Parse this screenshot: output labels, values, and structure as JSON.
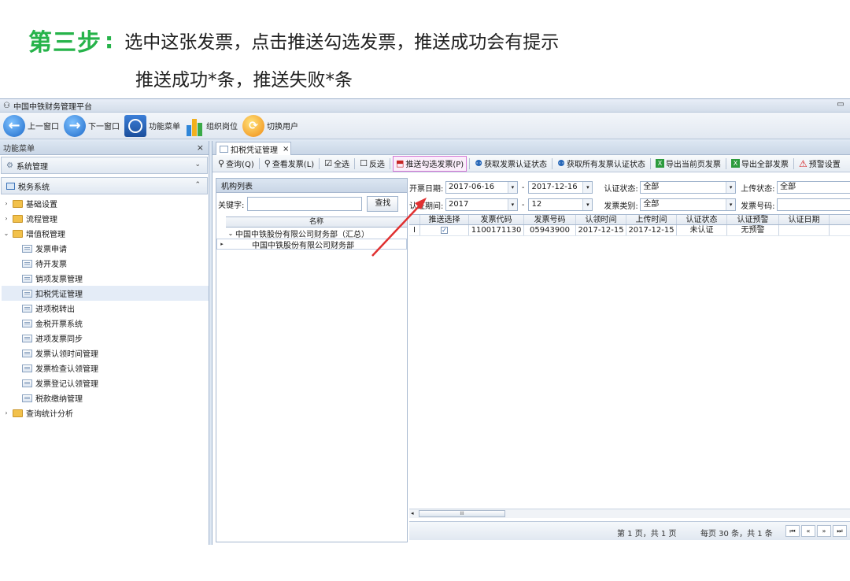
{
  "instructions": {
    "step_label": "第三步",
    "step_colon": ":",
    "line1": "选中这张发票，点击推送勾选发票，推送成功会有提示",
    "line2": "推送成功*条，推送失败*条"
  },
  "window": {
    "title": "中国中铁财务管理平台",
    "minimize": "▭"
  },
  "toolbar": {
    "prev": "上一窗口",
    "next": "下一窗口",
    "func_menu": "功能菜单",
    "org_post": "组织岗位",
    "switch_user": "切换用户"
  },
  "left_panel": {
    "title": "功能菜单",
    "close": "×",
    "group1": "系统管理",
    "group2": "税务系统",
    "tree": [
      {
        "label": "基础设置",
        "type": "folder",
        "arrow": "›"
      },
      {
        "label": "流程管理",
        "type": "folder",
        "arrow": "›"
      },
      {
        "label": "增值税管理",
        "type": "folder",
        "arrow": "⌄"
      },
      {
        "label": "发票申请",
        "type": "page"
      },
      {
        "label": "待开发票",
        "type": "page"
      },
      {
        "label": "销项发票管理",
        "type": "page"
      },
      {
        "label": "扣税凭证管理",
        "type": "page",
        "selected": true
      },
      {
        "label": "进项税转出",
        "type": "page"
      },
      {
        "label": "金税开票系统",
        "type": "page"
      },
      {
        "label": "进项发票同步",
        "type": "page"
      },
      {
        "label": "发票认领时间管理",
        "type": "page"
      },
      {
        "label": "发票检查认领管理",
        "type": "page"
      },
      {
        "label": "发票登记认领管理",
        "type": "page"
      },
      {
        "label": "税款缴纳管理",
        "type": "page"
      },
      {
        "label": "查询统计分析",
        "type": "folder",
        "arrow": "›"
      }
    ]
  },
  "tab": {
    "label": "扣税凭证管理",
    "close": "×"
  },
  "actions": {
    "query": "查询(Q)",
    "view_invoice": "查看发票(L)",
    "select_all": "全选",
    "invert": "反选",
    "push_selected": "推送勾选发票(P)",
    "get_status": "获取发票认证状态",
    "get_all_status": "获取所有发票认证状态",
    "export_page": "导出当前页发票",
    "export_all": "导出全部发票",
    "warning_settings": "预警设置"
  },
  "org_list": {
    "title": "机构列表",
    "keyword_label": "关键字:",
    "search_btn": "查找",
    "col_name": "名称",
    "rows": [
      {
        "name": "中国中铁股份有限公司财务部（汇总）",
        "ind": "⌄"
      },
      {
        "name": "中国中铁股份有限公司财务部",
        "ind": "▸"
      }
    ]
  },
  "filters": {
    "invoice_date_label": "开票日期:",
    "date_from": "2017-06-16",
    "dash": "-",
    "date_to": "2017-12-16",
    "cert_status_label": "认证状态:",
    "cert_status": "全部",
    "upload_status_label": "上传状态:",
    "upload_status": "全部",
    "cert_period_label": "认证期间:",
    "period_year": "2017",
    "period_month": "12",
    "invoice_type_label": "发票类别:",
    "invoice_type": "全部",
    "invoice_no_label": "发票号码:"
  },
  "grid": {
    "headers": [
      "推送选择",
      "发票代码",
      "发票号码",
      "认领时间",
      "上传时间",
      "认证状态",
      "认证预警",
      "认证日期"
    ],
    "rows": [
      {
        "marker": "I",
        "checked": "✓",
        "code": "1100171130",
        "number": "05943900",
        "claim_time": "2017-12-15",
        "upload_time": "2017-12-15",
        "cert_status": "未认证",
        "warning": "无预警",
        "cert_date": ""
      }
    ]
  },
  "scroll": {
    "left": "◂",
    "thumb": "III"
  },
  "pager": {
    "page_info": "第 1 页，共 1 页",
    "size_info": "每页 30 条，共 1 条",
    "nav": [
      "⏮",
      "«",
      "»",
      "⏭"
    ]
  },
  "colors": {
    "step_green": "#26b34a",
    "highlight_border": "#d77ad7",
    "arrow_red": "#e03030"
  }
}
